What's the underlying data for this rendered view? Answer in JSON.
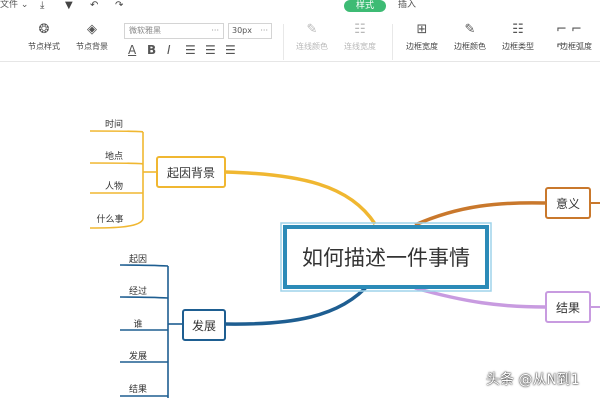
{
  "topbar": {
    "file_menu": "文件",
    "tabs": [
      {
        "label": "样式",
        "active": true
      },
      {
        "label": "插入",
        "active": false
      }
    ]
  },
  "toolbar": {
    "node_style": "节点样式",
    "node_background": "节点背景",
    "font_family_value": "微软雅黑",
    "font_size_value": "30px",
    "connector_color": "连线颜色",
    "connector_width": "连线宽度",
    "border_width": "边框宽度",
    "border_color": "边框颜色",
    "border_type": "边框类型",
    "border_radius": "边框弧度"
  },
  "mindmap": {
    "center": {
      "label": "如何描述一件事情",
      "border_color": "#2b8bb8"
    },
    "branches": [
      {
        "label": "起因背景",
        "color": "#f0b731",
        "children": [
          "时间",
          "地点",
          "人物",
          "什么事"
        ]
      },
      {
        "label": "发展",
        "color": "#1e5e91",
        "children": [
          "起因",
          "经过",
          "谁",
          "发展",
          "结果"
        ]
      },
      {
        "label": "意义",
        "color": "#c9782c",
        "children": []
      },
      {
        "label": "结果",
        "color": "#c89be0",
        "children": []
      }
    ]
  },
  "watermark": "头条 @从N到1"
}
